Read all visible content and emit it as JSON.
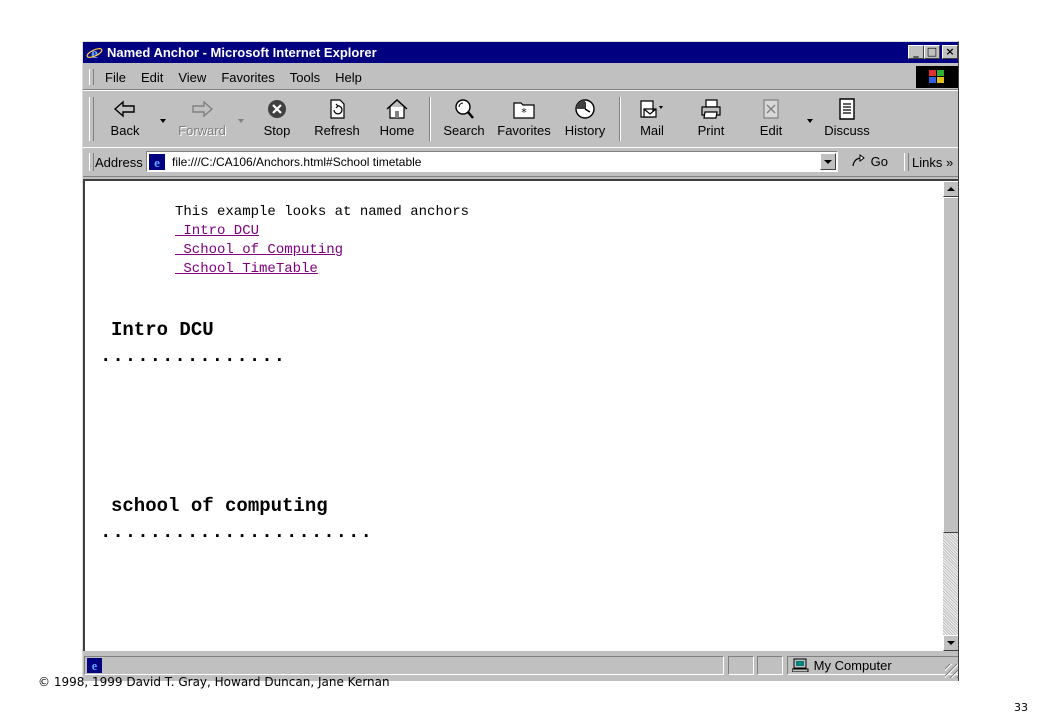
{
  "window": {
    "title": "Named Anchor - Microsoft Internet Explorer",
    "controls": [
      "_",
      "□",
      "×"
    ]
  },
  "menu": {
    "items": [
      "File",
      "Edit",
      "View",
      "Favorites",
      "Tools",
      "Help"
    ]
  },
  "toolbar": {
    "buttons": [
      {
        "label": "Back",
        "icon": "back-arrow-icon",
        "enabled": true
      },
      {
        "label": "Forward",
        "icon": "forward-arrow-icon",
        "enabled": false
      },
      {
        "label": "Stop",
        "icon": "stop-icon",
        "enabled": true
      },
      {
        "label": "Refresh",
        "icon": "refresh-icon",
        "enabled": true
      },
      {
        "label": "Home",
        "icon": "home-icon",
        "enabled": true
      },
      {
        "label": "Search",
        "icon": "search-icon",
        "enabled": true
      },
      {
        "label": "Favorites",
        "icon": "favorites-icon",
        "enabled": true
      },
      {
        "label": "History",
        "icon": "history-icon",
        "enabled": true
      },
      {
        "label": "Mail",
        "icon": "mail-icon",
        "enabled": true
      },
      {
        "label": "Print",
        "icon": "print-icon",
        "enabled": true
      },
      {
        "label": "Edit",
        "icon": "edit-icon",
        "enabled": true
      },
      {
        "label": "Discuss",
        "icon": "discuss-icon",
        "enabled": true
      }
    ]
  },
  "address": {
    "label": "Address",
    "url": "file:///C:/CA106/Anchors.html#School timetable",
    "go_label": "Go",
    "links_label": "Links »"
  },
  "page": {
    "intro": "This example looks at named anchors",
    "links": [
      " Intro DCU",
      " School of Computing",
      " School TimeTable"
    ],
    "sections": [
      {
        "heading": "Intro DCU",
        "rule": "..............."
      },
      {
        "heading": "school of computing",
        "rule": "......................"
      }
    ]
  },
  "status": {
    "zone": "My Computer"
  },
  "footer": {
    "copyright": "© 1998, 1999 David T. Gray, Howard Duncan, Jane Kernan",
    "page_number": "33"
  },
  "colors": {
    "title_bar": "#000080",
    "chrome": "#c0c0c0",
    "visited_link": "#800080"
  }
}
